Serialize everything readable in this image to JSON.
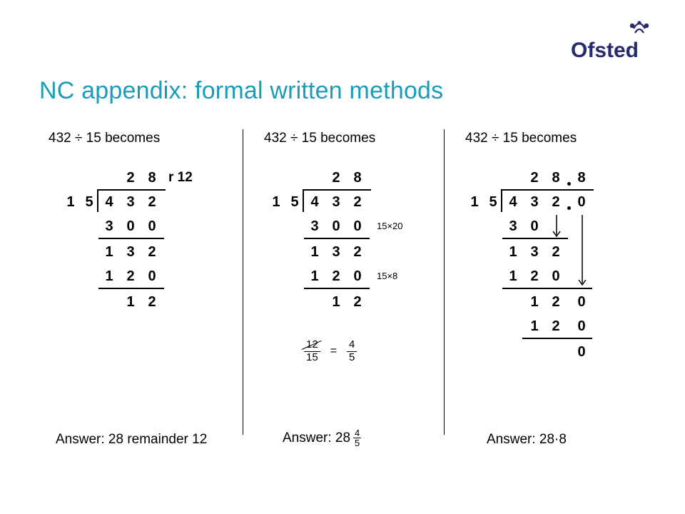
{
  "title": "NC appendix: formal written methods",
  "logo": {
    "name": "Ofsted"
  },
  "col1": {
    "heading": "432 ÷ 15 becomes",
    "quotient": [
      "2",
      "8"
    ],
    "remainder_label": "r 12",
    "divisor": [
      "1",
      "5"
    ],
    "dividend": [
      "4",
      "3",
      "2"
    ],
    "rows": [
      [
        "3",
        "0",
        "0"
      ],
      [
        "1",
        "3",
        "2"
      ],
      [
        "1",
        "2",
        "0"
      ],
      [
        "",
        "1",
        "2"
      ]
    ],
    "answer": "Answer: 28 remainder 12"
  },
  "col2": {
    "heading": "432 ÷ 15 becomes",
    "quotient": [
      "2",
      "8"
    ],
    "divisor": [
      "1",
      "5"
    ],
    "dividend": [
      "4",
      "3",
      "2"
    ],
    "rows": [
      [
        "3",
        "0",
        "0"
      ],
      [
        "1",
        "3",
        "2"
      ],
      [
        "1",
        "2",
        "0"
      ],
      [
        "",
        "1",
        "2"
      ]
    ],
    "notes": [
      "15×20",
      "15×8"
    ],
    "frac_reduce": {
      "from_top": "12",
      "from_bot": "15",
      "to_top": "4",
      "to_bot": "5",
      "eq": "="
    },
    "answer_prefix": "Answer: 28",
    "answer_frac_top": "4",
    "answer_frac_bot": "5"
  },
  "col3": {
    "heading": "432 ÷ 15 becomes",
    "quotient": [
      "2",
      "8",
      "8"
    ],
    "divisor": [
      "1",
      "5"
    ],
    "dividend": [
      "4",
      "3",
      "2",
      "0"
    ],
    "rows": [
      [
        "3",
        "0",
        "",
        ""
      ],
      [
        "1",
        "3",
        "2",
        ""
      ],
      [
        "1",
        "2",
        "0",
        ""
      ],
      [
        "",
        "1",
        "2",
        "0"
      ],
      [
        "",
        "1",
        "2",
        "0"
      ],
      [
        "",
        "",
        "",
        "0"
      ]
    ],
    "answer": "Answer: 28·8"
  }
}
